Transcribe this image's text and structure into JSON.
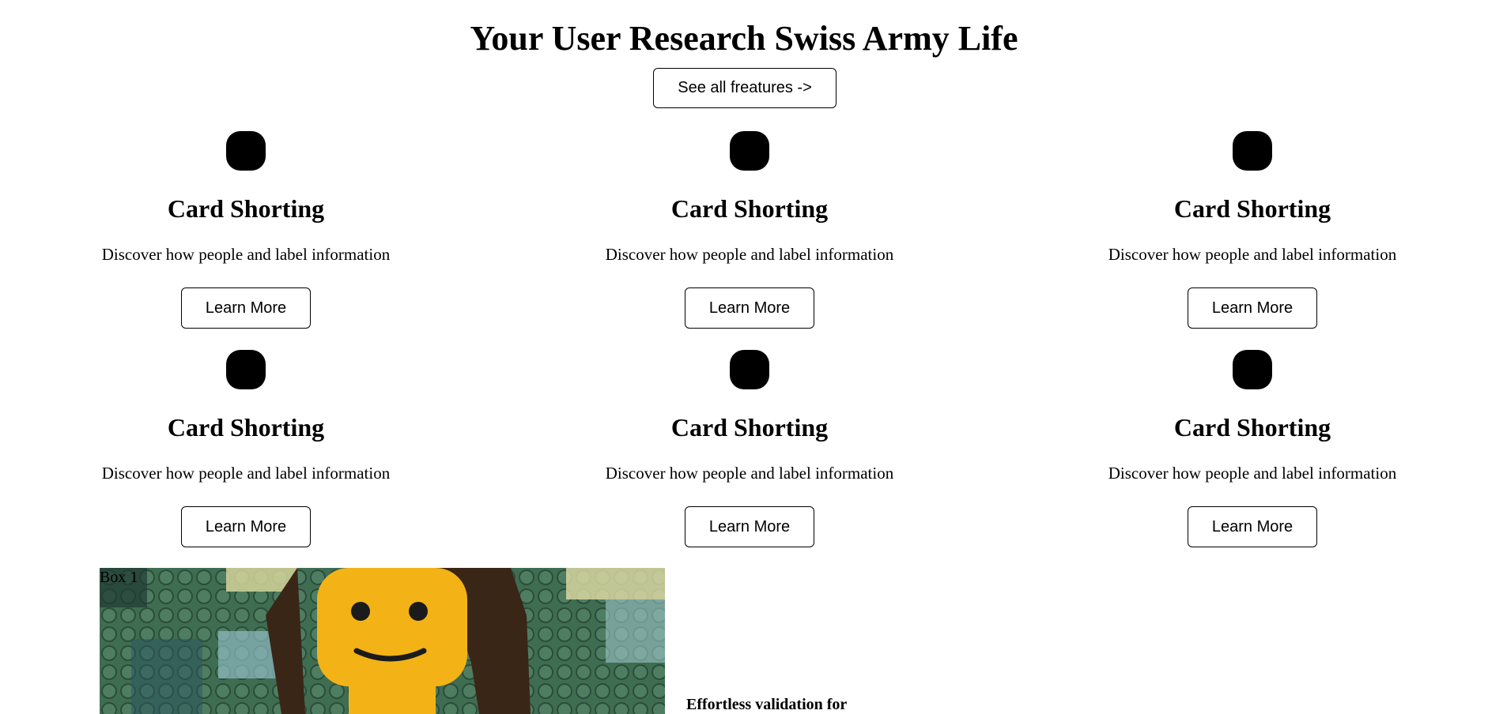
{
  "header": {
    "title": "Your User Research Swiss Army Life",
    "see_all_label": "See all freatures ->"
  },
  "cards": [
    {
      "icon": "rounded-square-icon",
      "title": "Card Shorting",
      "description": "Discover how people and label information",
      "button_label": "Learn More"
    },
    {
      "icon": "rounded-square-icon",
      "title": "Card Shorting",
      "description": "Discover how people and label information",
      "button_label": "Learn More"
    },
    {
      "icon": "rounded-square-icon",
      "title": "Card Shorting",
      "description": "Discover how people and label information",
      "button_label": "Learn More"
    },
    {
      "icon": "rounded-square-icon",
      "title": "Card Shorting",
      "description": "Discover how people and label information",
      "button_label": "Learn More"
    },
    {
      "icon": "rounded-square-icon",
      "title": "Card Shorting",
      "description": "Discover how people and label information",
      "button_label": "Learn More"
    },
    {
      "icon": "rounded-square-icon",
      "title": "Card Shorting",
      "description": "Discover how people and label information",
      "button_label": "Learn More"
    }
  ],
  "feature_section": {
    "box_label": "Box 1",
    "image_description": "lego-minifigure-mona-lisa-image",
    "heading": "Effortless validation for"
  }
}
